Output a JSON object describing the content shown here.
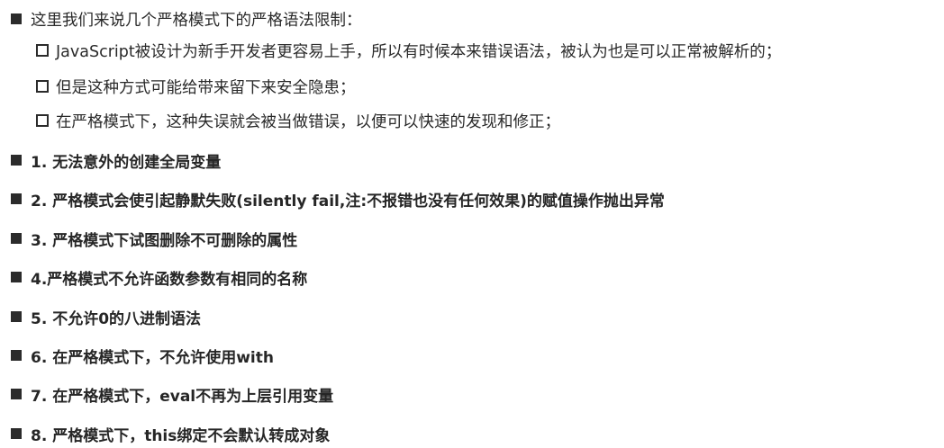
{
  "intro": {
    "text": "这里我们来说几个严格模式下的严格语法限制："
  },
  "sub_points": [
    {
      "text": "JavaScript被设计为新手开发者更容易上手，所以有时候本来错误语法，被认为也是可以正常被解析的；"
    },
    {
      "text": "但是这种方式可能给带来留下来安全隐患；"
    },
    {
      "text": "在严格模式下，这种失误就会被当做错误，以便可以快速的发现和修正；"
    }
  ],
  "rules": [
    {
      "text": "1. 无法意外的创建全局变量"
    },
    {
      "text": "2. 严格模式会使引起静默失败(silently fail,注:不报错也没有任何效果)的赋值操作抛出异常"
    },
    {
      "text": "3. 严格模式下试图删除不可删除的属性"
    },
    {
      "text": "4.严格模式不允许函数参数有相同的名称"
    },
    {
      "text": "5. 不允许0的八进制语法"
    },
    {
      "text": "6. 在严格模式下，不允许使用with"
    },
    {
      "text": "7. 在严格模式下，eval不再为上层引用变量"
    },
    {
      "text": "8. 严格模式下，this绑定不会默认转成对象"
    }
  ]
}
